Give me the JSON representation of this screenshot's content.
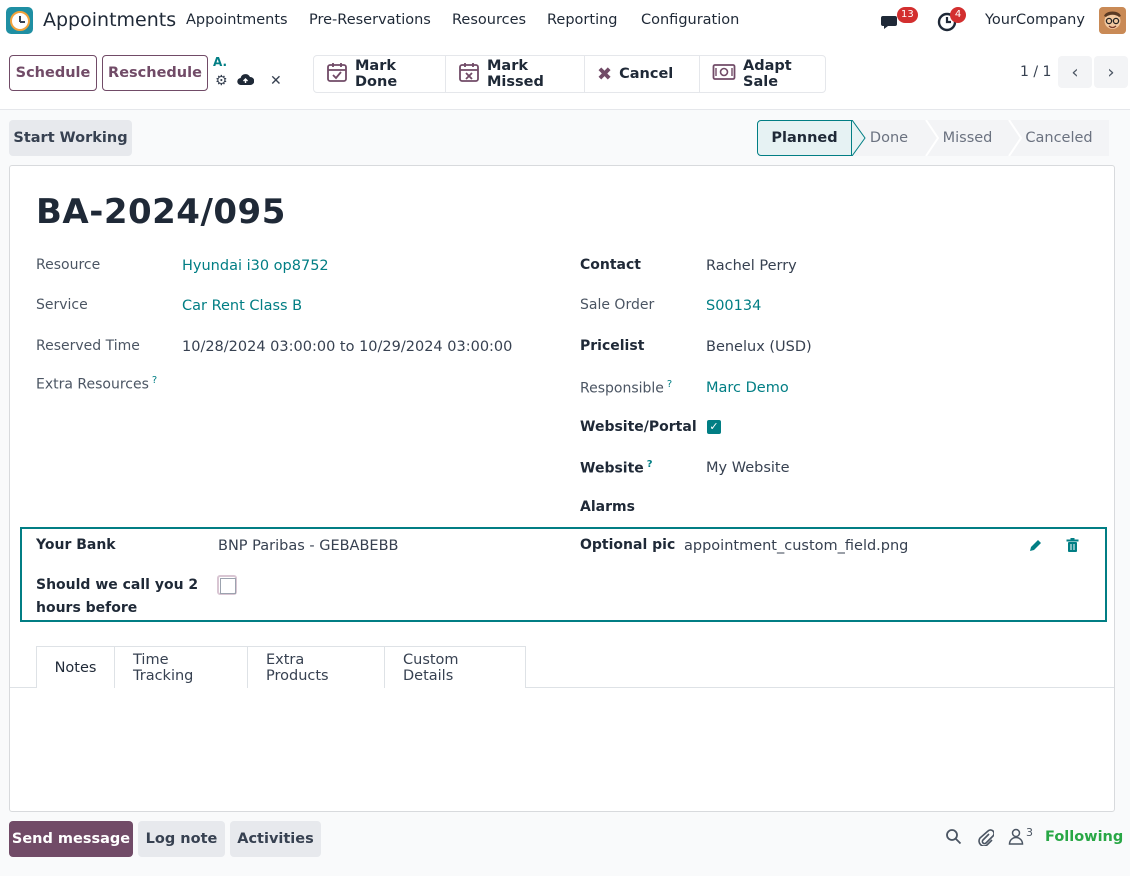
{
  "navbar": {
    "app_name": "Appointments",
    "menus": [
      "Appointments",
      "Pre-Reservations",
      "Resources",
      "Reporting",
      "Configuration"
    ],
    "messages_count": "13",
    "activities_count": "4",
    "company": "YourCompany"
  },
  "control": {
    "schedule_label": "Schedule",
    "reschedule_label": "Reschedule",
    "breadcrumb_short": "A.",
    "actions": [
      "Mark Done",
      "Mark Missed",
      "Cancel",
      "Adapt Sale"
    ],
    "pager": "1 / 1"
  },
  "status": {
    "start_working_label": "Start Working",
    "stages": [
      "Planned",
      "Done",
      "Missed",
      "Canceled"
    ],
    "active_stage": "Planned"
  },
  "record": {
    "name": "BA-2024/095",
    "left_fields": [
      {
        "label": "Resource",
        "value": "Hyundai i30 op8752"
      },
      {
        "label": "Service",
        "value": "Car Rent Class B"
      },
      {
        "label": "Reserved Time",
        "value": "10/28/2024 03:00:00 to 10/29/2024 03:00:00"
      },
      {
        "label": "Extra Resources",
        "value": ""
      }
    ],
    "right_fields": [
      {
        "label": "Contact",
        "value": "Rachel Perry"
      },
      {
        "label": "Sale Order",
        "value": "S00134"
      },
      {
        "label": "Pricelist",
        "value": "Benelux (USD)"
      },
      {
        "label": "Responsible",
        "value": "Marc Demo"
      },
      {
        "label": "Website/Portal",
        "value": ""
      },
      {
        "label": "Website",
        "value": "My Website"
      },
      {
        "label": "Alarms",
        "value": ""
      }
    ],
    "help_mark": "?"
  },
  "custom": {
    "bank_label": "Your Bank",
    "bank_value": "BNP Paribas - GEBABEBB",
    "call_label_1": "Should we call you 2",
    "call_label_2": "hours before",
    "pic_label": "Optional pic",
    "pic_value": "appointment_custom_field.png"
  },
  "tabs": [
    "Notes",
    "Time Tracking",
    "Extra Products",
    "Custom Details"
  ],
  "chatter": {
    "send_message": "Send message",
    "log_note": "Log note",
    "activities": "Activities",
    "followers_count": "3",
    "following": "Following"
  },
  "colors": {
    "brand": "#714b67",
    "accent": "#017e84",
    "badge": "#d32f2f",
    "following": "#28a745"
  }
}
